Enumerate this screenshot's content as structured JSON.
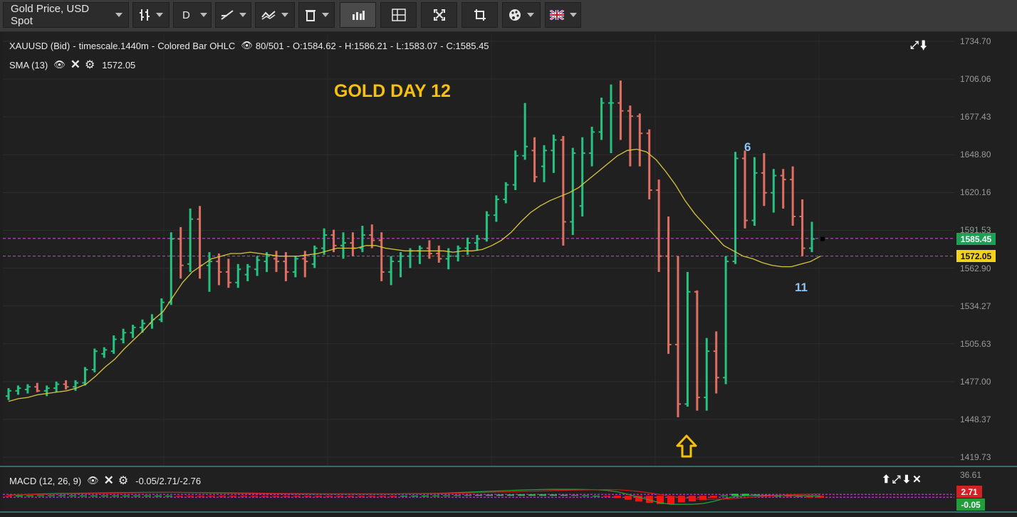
{
  "toolbar": {
    "symbol_label": "Gold Price, USD Spot",
    "bar_type_icon": "candle-bars-icon",
    "period_label": "D",
    "draw_icon": "line-draw-icon",
    "indicators_icon": "indicators-icon",
    "trash_icon": "trash-icon",
    "volume_icon": "volume-bars-icon",
    "layout_icon": "layout-grid-icon",
    "fullscreen_icon": "fullscreen-icon",
    "crop_icon": "crop-icon",
    "theme_icon": "palette-icon",
    "language_icon": "uk-flag-icon"
  },
  "header": {
    "symbol": "XAUUSD (Bid)",
    "timescale": "timescale.1440m",
    "style": "Colored Bar OHLC",
    "bars": "80/501",
    "open": "O:1584.62",
    "high": "H:1586.21",
    "low": "L:1583.07",
    "close": "C:1585.45",
    "sma_label": "SMA (13)",
    "sma_value": "1572.05"
  },
  "annotations": {
    "title": "GOLD DAY 12",
    "wave6": "6",
    "wave11": "11"
  },
  "macd": {
    "label": "MACD (12, 26, 9)",
    "values": "-0.05/2.71/-2.76",
    "axis_top": "36.61",
    "tag_signal": "2.71",
    "tag_hist": "-0.05"
  },
  "price_axis": {
    "labels": [
      "1734.70",
      "1706.06",
      "1677.43",
      "1648.80",
      "1620.16",
      "1591.53",
      "1562.90",
      "1534.27",
      "1505.63",
      "1477.00",
      "1448.37",
      "1419.73"
    ],
    "last_price": "1585.45",
    "sma_price": "1572.05"
  },
  "colors": {
    "up": "#26c281",
    "down": "#e06f63",
    "sma": "#d6c440",
    "title": "#f6c10e",
    "wave": "#8fc3ef",
    "level": "#b63fc8"
  },
  "chart_data": [
    {
      "type": "ohlc",
      "symbol": "XAUUSD (Bid)",
      "ylim": [
        1419.73,
        1734.7
      ],
      "levels": [
        1585.45,
        1572.05
      ],
      "series": [
        {
          "name": "XAUUSD (Bid)",
          "ohlc": [
            [
              1466,
              1472,
              1463,
              1470
            ],
            [
              1470,
              1474,
              1467,
              1472
            ],
            [
              1471,
              1475,
              1468,
              1473
            ],
            [
              1473,
              1476,
              1469,
              1470
            ],
            [
              1470,
              1474,
              1466,
              1472
            ],
            [
              1472,
              1477,
              1469,
              1475
            ],
            [
              1475,
              1478,
              1471,
              1473
            ],
            [
              1473,
              1478,
              1470,
              1476
            ],
            [
              1476,
              1488,
              1474,
              1486
            ],
            [
              1486,
              1502,
              1484,
              1500
            ],
            [
              1498,
              1503,
              1495,
              1501
            ],
            [
              1500,
              1512,
              1498,
              1509
            ],
            [
              1509,
              1517,
              1506,
              1514
            ],
            [
              1514,
              1520,
              1510,
              1518
            ],
            [
              1518,
              1524,
              1514,
              1521
            ],
            [
              1521,
              1528,
              1517,
              1524
            ],
            [
              1524,
              1540,
              1522,
              1537
            ],
            [
              1537,
              1590,
              1535,
              1585
            ],
            [
              1585,
              1594,
              1555,
              1565
            ],
            [
              1566,
              1608,
              1560,
              1600
            ],
            [
              1600,
              1610,
              1555,
              1565
            ],
            [
              1565,
              1575,
              1545,
              1568
            ],
            [
              1568,
              1574,
              1550,
              1560
            ],
            [
              1560,
              1570,
              1548,
              1552
            ],
            [
              1552,
              1566,
              1548,
              1562
            ],
            [
              1558,
              1566,
              1553,
              1564
            ],
            [
              1562,
              1572,
              1557,
              1569
            ],
            [
              1568,
              1575,
              1560,
              1572
            ],
            [
              1570,
              1576,
              1560,
              1568
            ],
            [
              1568,
              1575,
              1553,
              1560
            ],
            [
              1560,
              1572,
              1556,
              1570
            ],
            [
              1570,
              1576,
              1556,
              1568
            ],
            [
              1566,
              1580,
              1563,
              1578
            ],
            [
              1578,
              1593,
              1573,
              1588
            ],
            [
              1588,
              1592,
              1575,
              1580
            ],
            [
              1580,
              1590,
              1570,
              1582
            ],
            [
              1582,
              1590,
              1572,
              1578
            ],
            [
              1578,
              1595,
              1575,
              1588
            ],
            [
              1588,
              1596,
              1578,
              1584
            ],
            [
              1584,
              1590,
              1553,
              1560
            ],
            [
              1560,
              1572,
              1550,
              1568
            ],
            [
              1568,
              1575,
              1556,
              1572
            ],
            [
              1572,
              1578,
              1563,
              1576
            ],
            [
              1576,
              1580,
              1566,
              1578
            ],
            [
              1578,
              1584,
              1570,
              1574
            ],
            [
              1574,
              1580,
              1567,
              1570
            ],
            [
              1570,
              1578,
              1562,
              1572
            ],
            [
              1572,
              1580,
              1568,
              1578
            ],
            [
              1578,
              1586,
              1573,
              1582
            ],
            [
              1582,
              1588,
              1576,
              1585
            ],
            [
              1585,
              1606,
              1583,
              1603
            ],
            [
              1603,
              1618,
              1598,
              1615
            ],
            [
              1615,
              1628,
              1612,
              1626
            ],
            [
              1626,
              1652,
              1622,
              1648
            ],
            [
              1648,
              1688,
              1645,
              1655
            ],
            [
              1652,
              1662,
              1628,
              1632
            ],
            [
              1640,
              1656,
              1628,
              1652
            ],
            [
              1652,
              1664,
              1635,
              1660
            ],
            [
              1660,
              1663,
              1580,
              1598
            ],
            [
              1598,
              1654,
              1588,
              1650
            ],
            [
              1610,
              1662,
              1602,
              1650
            ],
            [
              1650,
              1670,
              1640,
              1666
            ],
            [
              1666,
              1692,
              1660,
              1688
            ],
            [
              1688,
              1702,
              1650,
              1688
            ],
            [
              1688,
              1705,
              1660,
              1682
            ],
            [
              1682,
              1686,
              1640,
              1678
            ],
            [
              1678,
              1680,
              1640,
              1665
            ],
            [
              1665,
              1668,
              1615,
              1622
            ],
            [
              1622,
              1630,
              1560,
              1572
            ],
            [
              1572,
              1602,
              1498,
              1505
            ],
            [
              1505,
              1572,
              1450,
              1460
            ],
            [
              1460,
              1560,
              1458,
              1545
            ],
            [
              1545,
              1546,
              1455,
              1465
            ],
            [
              1465,
              1510,
              1455,
              1500
            ],
            [
              1500,
              1515,
              1468,
              1480
            ],
            [
              1480,
              1572,
              1475,
              1568
            ],
            [
              1568,
              1651,
              1566,
              1646
            ],
            [
              1646,
              1652,
              1593,
              1599
            ],
            [
              1599,
              1647,
              1595,
              1635
            ],
            [
              1635,
              1650,
              1610,
              1620
            ],
            [
              1620,
              1638,
              1605,
              1633
            ],
            [
              1633,
              1638,
              1608,
              1630
            ],
            [
              1630,
              1640,
              1595,
              1602
            ],
            [
              1602,
              1615,
              1572,
              1578
            ],
            [
              1578,
              1598,
              1575,
              1585
            ]
          ]
        },
        {
          "name": "SMA (13)",
          "values": [
            1462,
            1464,
            1465,
            1467,
            1468,
            1469,
            1470,
            1472,
            1475,
            1481,
            1488,
            1494,
            1502,
            1509,
            1516,
            1524,
            1530,
            1541,
            1552,
            1560,
            1565,
            1570,
            1572,
            1574,
            1574,
            1575,
            1574,
            1573,
            1572,
            1572,
            1572,
            1573,
            1574,
            1576,
            1578,
            1578,
            1578,
            1580,
            1580,
            1578,
            1577,
            1576,
            1576,
            1576,
            1576,
            1576,
            1575,
            1576,
            1576,
            1577,
            1580,
            1584,
            1590,
            1598,
            1605,
            1610,
            1614,
            1617,
            1620,
            1624,
            1630,
            1636,
            1642,
            1648,
            1652,
            1653,
            1651,
            1645,
            1636,
            1626,
            1614,
            1604,
            1596,
            1588,
            1580,
            1576,
            1572,
            1570,
            1567,
            1565,
            1564,
            1564,
            1566,
            1568,
            1572
          ]
        }
      ]
    },
    {
      "type": "macd",
      "title": "MACD (12, 26, 9)",
      "ylim": [
        -20,
        36.61
      ],
      "series": [
        {
          "name": "MACD",
          "values": [
            0.8,
            1.4,
            2.0,
            2.6,
            3.0,
            3.4,
            3.6,
            3.8,
            4.0,
            4.2,
            4.4,
            4.6,
            4.8,
            5.0,
            5.0,
            5.0,
            4.8,
            4.6,
            4.4,
            4.2,
            4.0,
            3.8,
            3.6,
            3.4,
            3.2,
            3.0,
            2.8,
            2.6,
            2.6,
            2.6,
            2.6,
            2.6,
            2.6,
            2.6,
            2.6,
            2.6,
            2.6,
            2.8,
            3.0,
            3.2,
            3.6,
            4.0,
            4.6,
            5.2,
            5.8,
            6.4,
            7.0,
            7.6,
            8.2,
            8.6,
            9.0,
            9.2,
            9.2,
            9.2,
            9.0,
            8.6,
            7.6,
            5.6,
            2.0,
            -2.0,
            -6.0,
            -10.0,
            -12.0,
            -12.0,
            -12.0,
            -11.0,
            -8.0,
            -4.0,
            -1.0,
            0.2,
            0.4,
            0.6,
            0.6,
            0.4,
            0.2,
            0.0,
            -0.05
          ]
        },
        {
          "name": "Signal",
          "values": [
            1.0,
            1.2,
            1.6,
            2.0,
            2.4,
            2.8,
            3.1,
            3.4,
            3.6,
            3.8,
            4.0,
            4.2,
            4.4,
            4.6,
            4.8,
            4.9,
            4.9,
            4.8,
            4.7,
            4.6,
            4.5,
            4.3,
            4.1,
            3.9,
            3.7,
            3.5,
            3.3,
            3.1,
            3.0,
            2.9,
            2.8,
            2.8,
            2.8,
            2.8,
            2.8,
            2.8,
            2.8,
            2.8,
            2.9,
            3.0,
            3.2,
            3.4,
            3.8,
            4.2,
            4.6,
            5.0,
            5.4,
            5.8,
            6.2,
            6.6,
            7.0,
            7.4,
            7.8,
            8.2,
            8.4,
            8.6,
            8.8,
            8.6,
            7.6,
            6.2,
            4.2,
            1.8,
            -0.6,
            -2.6,
            -4.0,
            -4.8,
            -5.0,
            -4.6,
            -3.8,
            -2.6,
            -1.4,
            -0.4,
            0.6,
            1.4,
            2.0,
            2.4,
            2.71
          ]
        },
        {
          "name": "Histogram",
          "values": [
            -0.2,
            0.2,
            0.4,
            0.6,
            0.6,
            0.6,
            0.5,
            0.4,
            0.4,
            0.4,
            0.4,
            0.4,
            0.4,
            0.4,
            0.2,
            0.1,
            -0.1,
            -0.2,
            -0.3,
            -0.4,
            -0.5,
            -0.5,
            -0.5,
            -0.5,
            -0.5,
            -0.5,
            -0.5,
            -0.5,
            -0.4,
            -0.3,
            -0.2,
            -0.2,
            -0.2,
            -0.2,
            -0.2,
            -0.2,
            -0.2,
            0.0,
            0.1,
            0.2,
            0.4,
            0.6,
            0.8,
            1.0,
            1.2,
            1.4,
            1.6,
            1.8,
            2.0,
            2.0,
            2.0,
            1.8,
            1.4,
            1.0,
            0.6,
            0.0,
            -1.2,
            -3.0,
            -5.6,
            -8.2,
            -10.2,
            -11.8,
            -11.4,
            -9.4,
            -8.0,
            -6.2,
            -3.0,
            0.6,
            2.8,
            2.8,
            1.8,
            1.0,
            0.0,
            -1.0,
            -1.8,
            -2.4,
            -2.76
          ]
        }
      ]
    }
  ]
}
